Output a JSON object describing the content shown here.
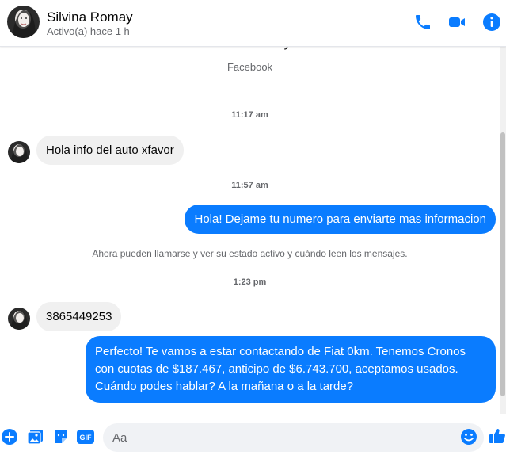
{
  "header": {
    "name": "Silvina Romay",
    "status": "Activo(a) hace 1 h"
  },
  "conversation": {
    "cut_name": "Silvina Romay",
    "platform": "Facebook",
    "timestamps": [
      "11:17 am",
      "11:57 am",
      "1:23 pm"
    ],
    "notice": "Ahora pueden llamarse y ver su estado activo y cuándo leen los mensajes.",
    "messages": [
      {
        "from": "them",
        "text": "Hola info del auto xfavor"
      },
      {
        "from": "me",
        "text": "Hola! Dejame tu numero para enviarte mas informacion"
      },
      {
        "from": "them",
        "text": "3865449253"
      },
      {
        "from": "me",
        "text": "Perfecto! Te vamos a estar contactando de Fiat 0km. Tenemos Cronos con cuotas de $187.467, anticipo de $6.743.700, aceptamos usados. Cuándo podes hablar? A la mañana o a la tarde?"
      }
    ]
  },
  "composer": {
    "placeholder": "Aa",
    "gif_label": "GIF"
  },
  "colors": {
    "accent": "#0a7cff",
    "incoming_bubble": "#f0f0f0"
  },
  "icons": [
    "phone-icon",
    "video-icon",
    "info-icon",
    "plus-icon",
    "image-icon",
    "sticker-icon",
    "gif-icon",
    "emoji-icon",
    "like-icon"
  ]
}
